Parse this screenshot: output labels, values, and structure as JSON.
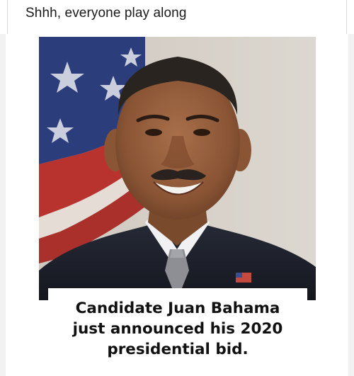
{
  "post": {
    "caption": "Shhh, everyone play along"
  },
  "meme": {
    "photo_icon": "portrait-photo",
    "caption_lines": [
      "Candidate Juan Bahama",
      "just announced his 2020",
      "presidential bid."
    ]
  },
  "colors": {
    "background": "#f2f2f2",
    "flag_blue": "#2b3d7a",
    "flag_red": "#b8332e",
    "suit": "#1c1f2a",
    "text": "#111111"
  }
}
